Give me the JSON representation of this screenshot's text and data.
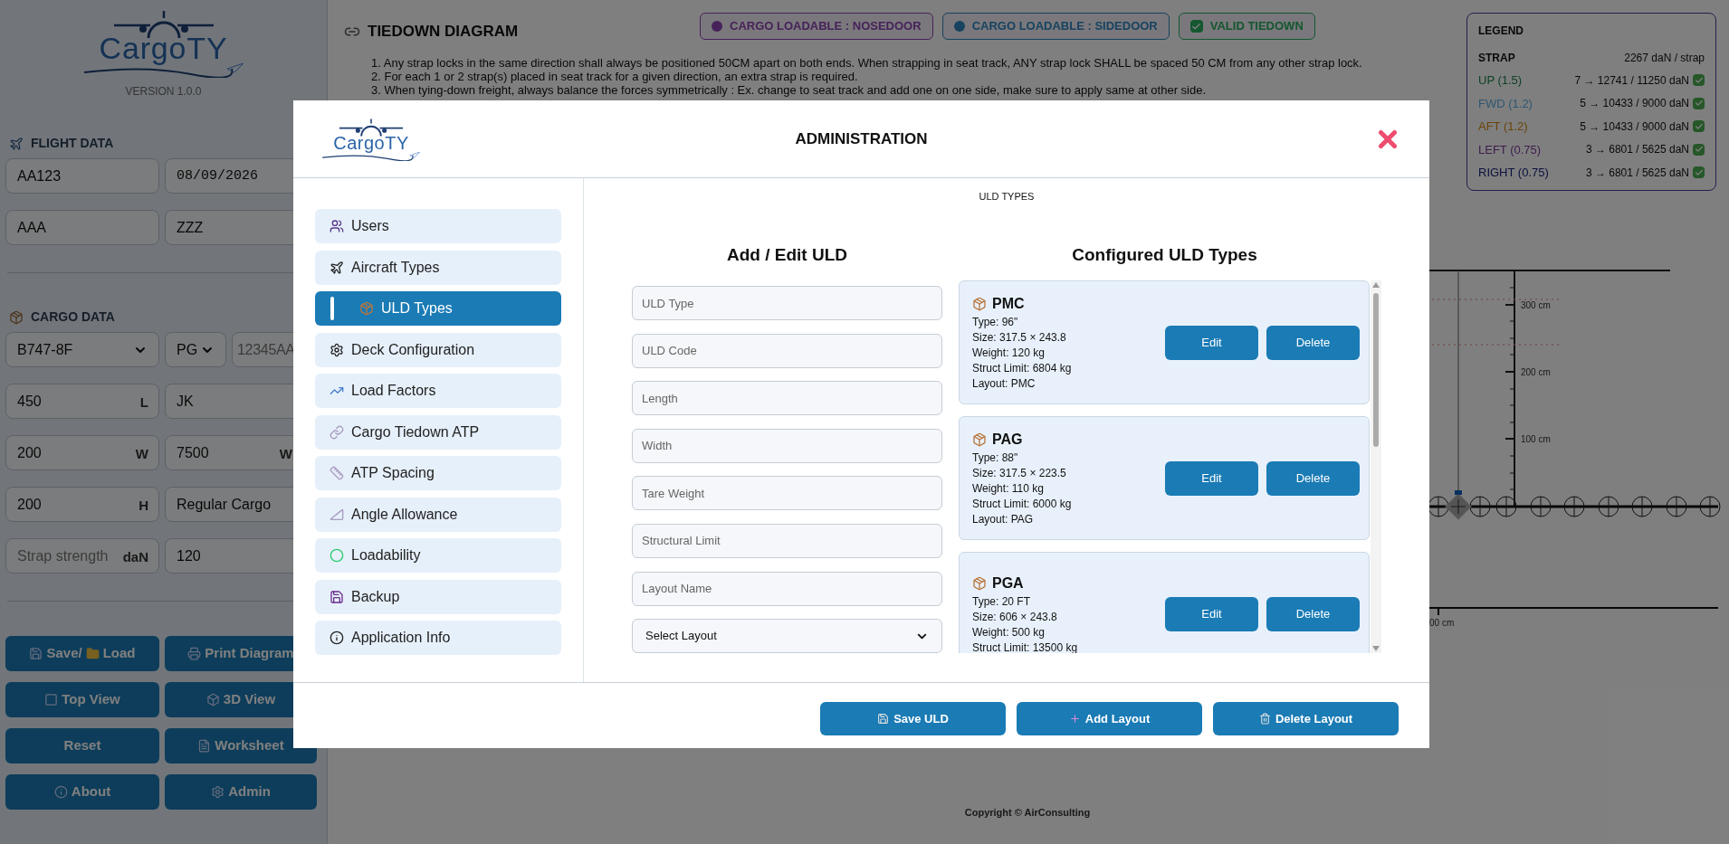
{
  "sidebar": {
    "logo_text": "CargoTY",
    "version": "VERSION 1.0.0",
    "flight_data": {
      "title": "FLIGHT DATA",
      "rows": [
        [
          {
            "kind": "input",
            "value": "AA123"
          },
          {
            "kind": "date",
            "value": "08/09/2026"
          }
        ],
        [
          {
            "kind": "input",
            "value": "AAA"
          },
          {
            "kind": "input",
            "value": "ZZZ"
          }
        ]
      ]
    },
    "cargo_data": {
      "title": "CARGO DATA",
      "rows": [
        [
          {
            "kind": "select",
            "value": "B747-8F"
          },
          {
            "kind": "select",
            "value": "PG"
          },
          {
            "kind": "input",
            "placeholder": "12345AA"
          }
        ],
        [
          {
            "kind": "input",
            "value": "450",
            "unit": "L"
          },
          {
            "kind": "input",
            "value": "JK"
          }
        ],
        [
          {
            "kind": "input",
            "value": "200",
            "unit": "W"
          },
          {
            "kind": "input",
            "value": "7500",
            "unit": "W"
          }
        ],
        [
          {
            "kind": "input",
            "value": "200",
            "unit": "H"
          },
          {
            "kind": "input",
            "value": "Regular Cargo"
          }
        ],
        [
          {
            "kind": "input",
            "placeholder": "Strap strength",
            "unit": "daN"
          },
          {
            "kind": "input",
            "value": "120"
          }
        ]
      ]
    },
    "buttons": [
      {
        "label": "Save/",
        "label_2": "Load"
      },
      {
        "label": "Print Diagram"
      },
      {
        "label": "Top View"
      },
      {
        "label": "3D View"
      },
      {
        "label": "Reset"
      },
      {
        "label": "Worksheet"
      },
      {
        "label": "About"
      },
      {
        "label": "Admin"
      }
    ]
  },
  "main": {
    "title": "TIEDOWN DIAGRAM",
    "badges": [
      {
        "kind": "dot",
        "label": "CARGO LOADABLE : NOSEDOOR",
        "color": "#47225a"
      },
      {
        "kind": "dot",
        "label": "CARGO LOADABLE : SIDEDOOR",
        "color": "#174360"
      },
      {
        "kind": "check",
        "label": "VALID TIEDOWN",
        "color": "#145730"
      }
    ],
    "rules": [
      "1. Any strap locks in the same direction shall always be positioned 50CM apart on both ends. When strapping in seat track, ANY strap lock SHALL be spaced 50 CM from any other strap lock.",
      "2. For each 1 or 2 strap(s) placed in seat track for a given direction, an extra strap is required.",
      "3. When tying-down freight, always balance the forces symmetrically : Ex. change to seat track and add one on one side, make sure to apply same at other side."
    ],
    "legend": {
      "title": "LEGEND",
      "strap_label": "STRAP",
      "strap_value": "2267 daN / strap",
      "rows": [
        {
          "label": "UP (1.5)",
          "value": "7 → 12741 / 11250 daN",
          "kind": "up",
          "valid": true
        },
        {
          "label": "FWD (1.2)",
          "value": "5 → 10433 / 9000 daN",
          "kind": "fwd",
          "valid": true
        },
        {
          "label": "AFT (1.2)",
          "value": "5 → 10433 / 9000 daN",
          "kind": "aft",
          "valid": true
        },
        {
          "label": "LEFT (0.75)",
          "value": "3 → 6801 / 5625 daN",
          "kind": "left",
          "valid": true
        },
        {
          "label": "RIGHT (0.75)",
          "value": "3 → 6801 / 5625 daN",
          "kind": "right",
          "valid": true
        }
      ]
    },
    "diagram": {
      "y_labels": [
        "300 cm",
        "200 cm",
        "100 cm"
      ],
      "x_label": "00 cm"
    },
    "copyright": "Copyright © AirConsulting"
  },
  "modal": {
    "logo_text": "CargoTY",
    "title": "ADMINISTRATION",
    "nav": [
      {
        "label": "Users",
        "selected": false
      },
      {
        "label": "Aircraft Types",
        "selected": false
      },
      {
        "label": "ULD Types",
        "selected": true
      },
      {
        "label": "Deck Configuration",
        "selected": false
      },
      {
        "label": "Load Factors",
        "selected": false
      },
      {
        "label": "Cargo Tiedown ATP",
        "selected": false
      },
      {
        "label": "ATP Spacing",
        "selected": false
      },
      {
        "label": "Angle Allowance",
        "selected": false
      },
      {
        "label": "Loadability",
        "selected": false
      },
      {
        "label": "Backup",
        "selected": false
      },
      {
        "label": "Application Info",
        "selected": false
      }
    ],
    "section_title": "ULD TYPES",
    "form": {
      "title": "Add / Edit ULD",
      "fields": [
        {
          "kind": "input",
          "placeholder": "ULD Type"
        },
        {
          "kind": "input",
          "placeholder": "ULD Code"
        },
        {
          "kind": "input",
          "placeholder": "Length"
        },
        {
          "kind": "input",
          "placeholder": "Width"
        },
        {
          "kind": "input",
          "placeholder": "Tare Weight"
        },
        {
          "kind": "input",
          "placeholder": "Structural Limit"
        },
        {
          "kind": "input",
          "placeholder": "Layout Name"
        },
        {
          "kind": "select",
          "value": "Select Layout"
        }
      ]
    },
    "list": {
      "title": "Configured ULD Types",
      "items": [
        {
          "name": "PMC",
          "lines": [
            "Type: 96\"",
            "Size: 317.5 × 243.8",
            "Weight: 120 kg",
            "Struct Limit: 6804 kg",
            "Layout: PMC"
          ],
          "buttons": [
            "Edit",
            "Delete"
          ]
        },
        {
          "name": "PAG",
          "lines": [
            "Type: 88\"",
            "Size: 317.5 × 223.5",
            "Weight: 110 kg",
            "Struct Limit: 6000 kg",
            "Layout: PAG"
          ],
          "buttons": [
            "Edit",
            "Delete"
          ]
        },
        {
          "name": "PGA",
          "lines": [
            "Type: 20 FT",
            "Size: 606 × 243.8",
            "Weight: 500 kg",
            "Struct Limit: 13500 kg"
          ],
          "buttons": [
            "Edit",
            "Delete"
          ]
        }
      ]
    },
    "footer_buttons": [
      "Save ULD",
      "Add Layout",
      "Delete Layout"
    ]
  }
}
